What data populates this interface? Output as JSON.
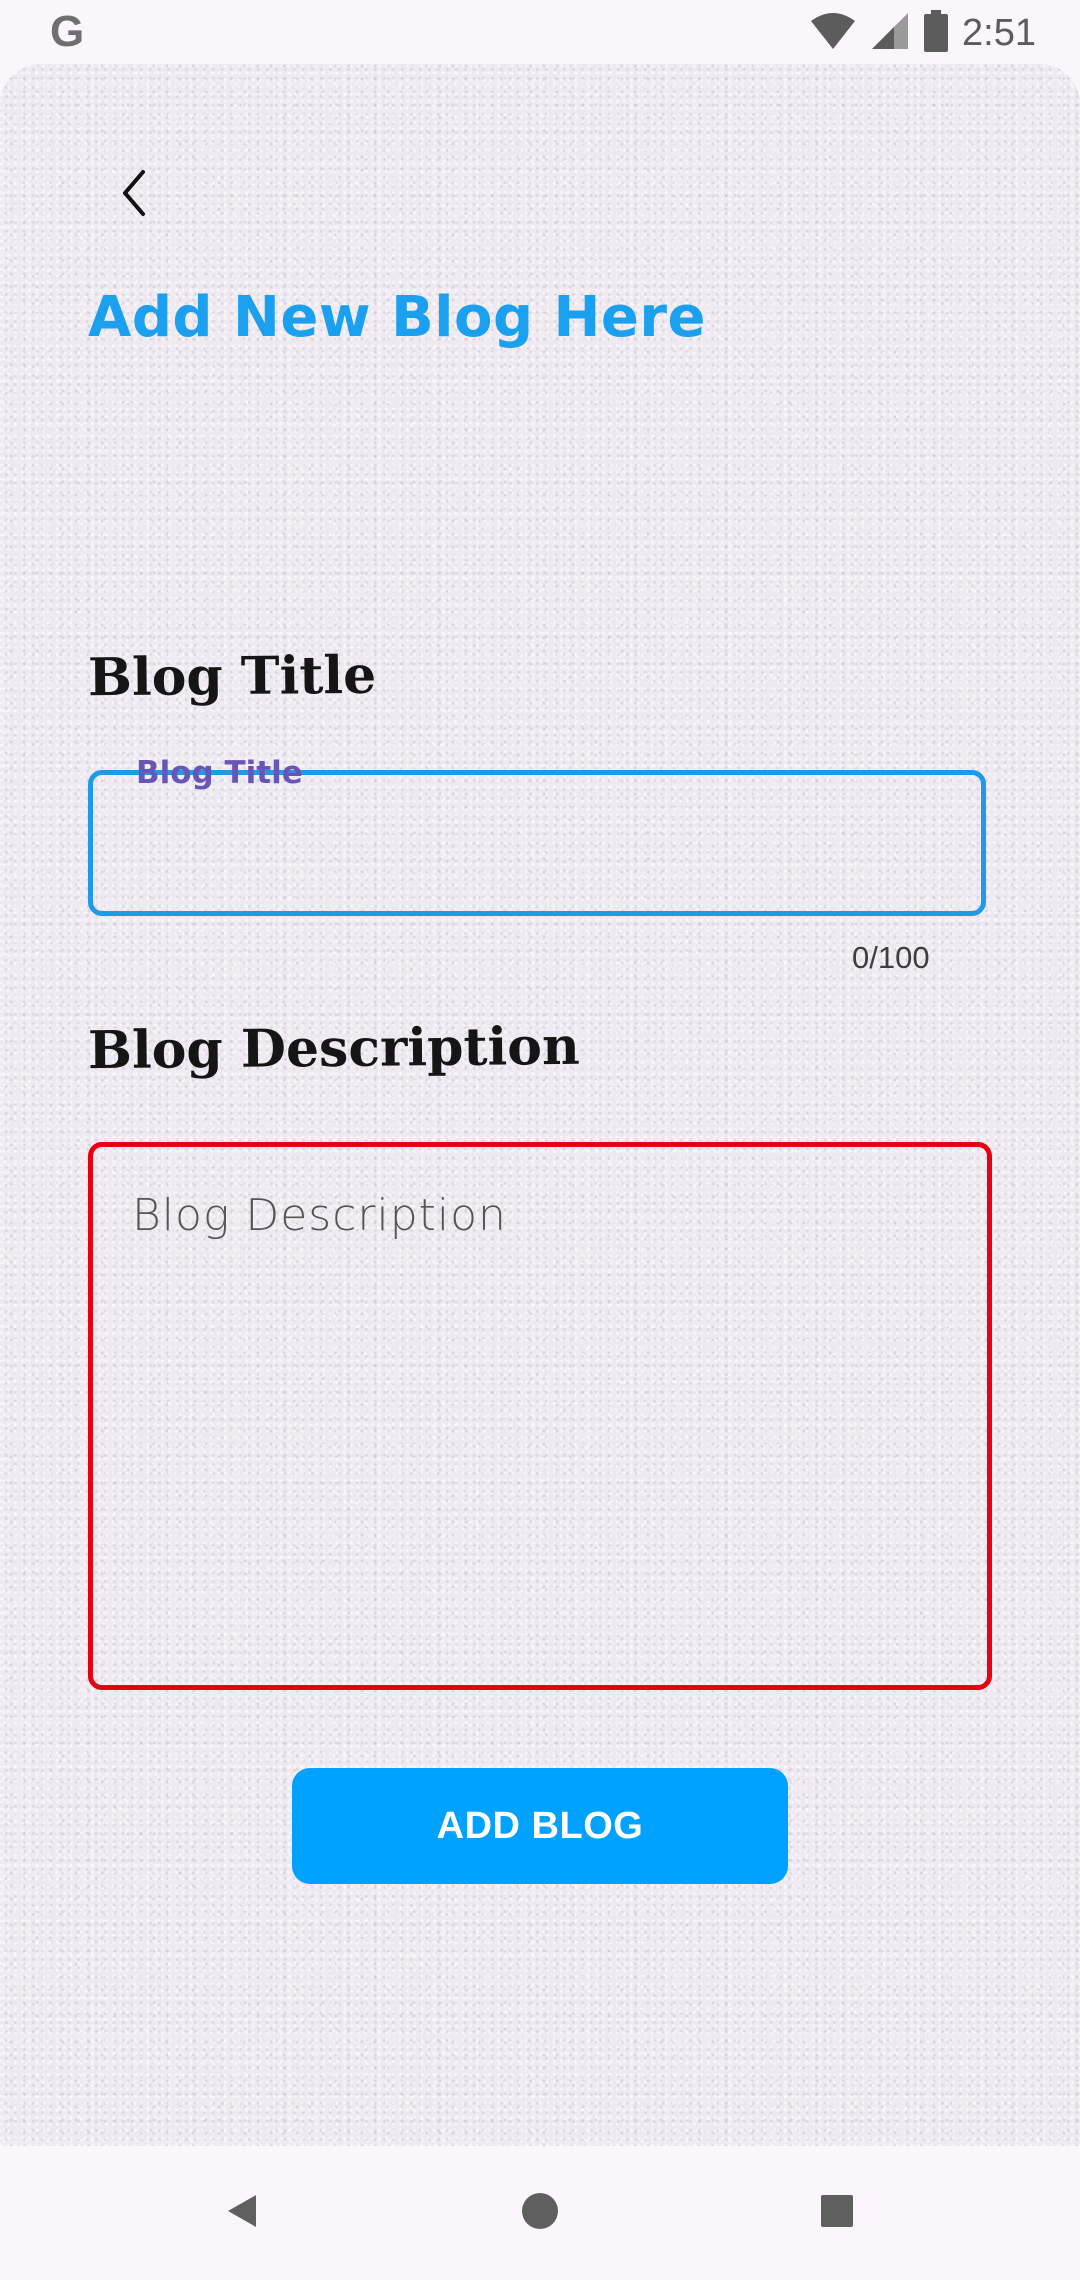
{
  "status_bar": {
    "app_icon": "google-g-icon",
    "app_letter": "G",
    "icons": [
      "wifi-icon",
      "cellular-signal-icon",
      "battery-icon"
    ],
    "time": "2:51"
  },
  "header": {
    "back_icon": "chevron-left-icon",
    "title": "Add New Blog Here"
  },
  "form": {
    "title_section_label": "Blog Title",
    "title_field": {
      "floating_label": "Blog Title",
      "value": "",
      "counter": "0/100"
    },
    "description_section_label": "Blog Description",
    "description_field": {
      "placeholder": "Blog Description",
      "value": ""
    },
    "submit_label": "ADD BLOG"
  },
  "nav_bar": {
    "back_icon": "triangle-back-icon",
    "home_icon": "circle-home-icon",
    "recents_icon": "square-recents-icon"
  },
  "colors": {
    "accent": "#1aa0ee",
    "button": "#00a2ff",
    "title_border": "#1e9be8",
    "description_border": "#e60012",
    "floating_label": "#6a55b6"
  }
}
